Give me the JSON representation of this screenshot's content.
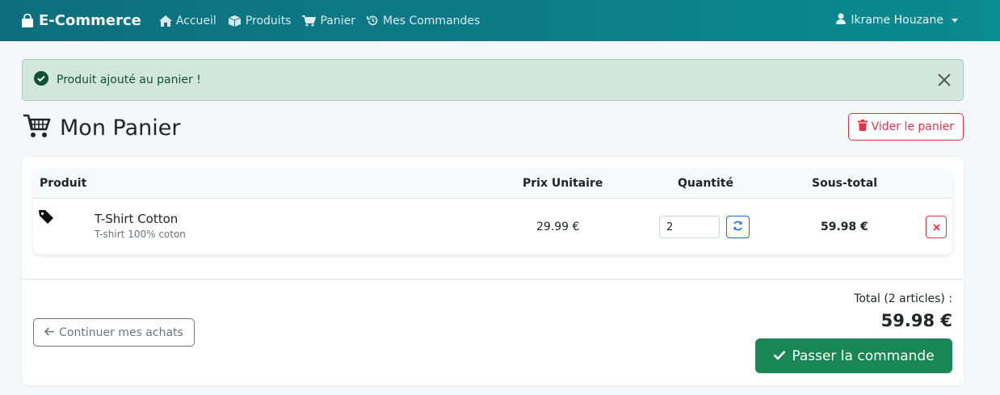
{
  "navbar": {
    "brand": "E-Commerce",
    "items": [
      {
        "label": "Accueil",
        "icon": "home-icon"
      },
      {
        "label": "Produits",
        "icon": "box-icon"
      },
      {
        "label": "Panier",
        "icon": "cart-icon"
      },
      {
        "label": "Mes Commandes",
        "icon": "history-icon"
      }
    ],
    "user": "Ikrame Houzane"
  },
  "alert": {
    "message": "Produit ajouté au panier !",
    "type": "success"
  },
  "page": {
    "title": "Mon Panier",
    "clear_button": "Vider le panier"
  },
  "table": {
    "headers": [
      "Produit",
      "Prix Unitaire",
      "Quantité",
      "Sous-total"
    ],
    "rows": [
      {
        "name": "T-Shirt Cotton",
        "description": "T-shirt 100% coton",
        "price": "29.99 €",
        "quantity": "2",
        "subtotal": "59.98 €"
      }
    ]
  },
  "footer": {
    "continue_button": "Continuer mes achats",
    "total_label": "Total (2 articles) :",
    "total_value": "59.98 €",
    "order_button": "Passer la commande"
  },
  "colors": {
    "navbar_start": "#0e6e7e",
    "navbar_end": "#0a8a91",
    "success": "#198754",
    "danger": "#dc3545",
    "primary": "#0d6efd"
  }
}
